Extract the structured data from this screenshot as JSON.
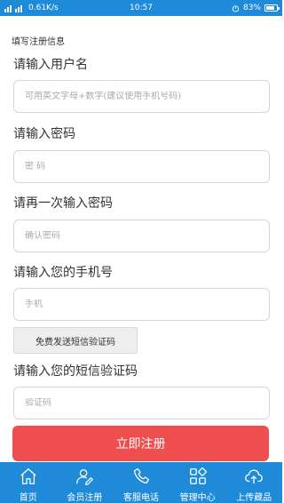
{
  "status_bar": {
    "left_text": "0.61K/s",
    "time": "10:57",
    "battery": "83%",
    "battery_level": 0.83
  },
  "form": {
    "section_title": "填写注册信息",
    "username_label": "请输入用户名",
    "username_placeholder": "可用英文字母+数字(建议使用手机号码)",
    "password_label": "请输入密码",
    "password_placeholder": "密 码",
    "confirm_label": "请再一次输入密码",
    "confirm_placeholder": "确认密码",
    "phone_label": "请输入您的手机号",
    "phone_placeholder": "手机",
    "sms_button": "免费发送短信验证码",
    "code_label": "请输入您的短信验证码",
    "code_placeholder": "验证码",
    "submit": "立即注册"
  },
  "nav": {
    "items": [
      {
        "label": "首页",
        "icon": "home-icon"
      },
      {
        "label": "会员注册",
        "icon": "member-icon"
      },
      {
        "label": "客服电话",
        "icon": "phone-icon"
      },
      {
        "label": "管理中心",
        "icon": "grid-icon"
      },
      {
        "label": "上传藏品",
        "icon": "cloud-upload-icon"
      }
    ]
  }
}
